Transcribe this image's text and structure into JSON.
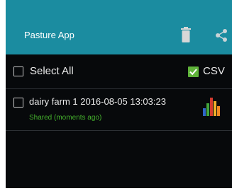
{
  "app_bar": {
    "title": "Pasture App",
    "background": "#1b8ca0",
    "actions": [
      {
        "icon": "trash-icon"
      },
      {
        "icon": "share-icon"
      }
    ]
  },
  "list_header": {
    "select_all_label": "Select All",
    "select_all_checked": false,
    "csv_label": "CSV",
    "csv_checked": true,
    "csv_color": "#5fb33a"
  },
  "records": [
    {
      "name": "dairy farm 1 2016-08-05 13:03:23",
      "status": "Shared (moments ago)",
      "status_color": "#44b02c",
      "checked": false,
      "icon": "bar-chart-icon"
    }
  ]
}
